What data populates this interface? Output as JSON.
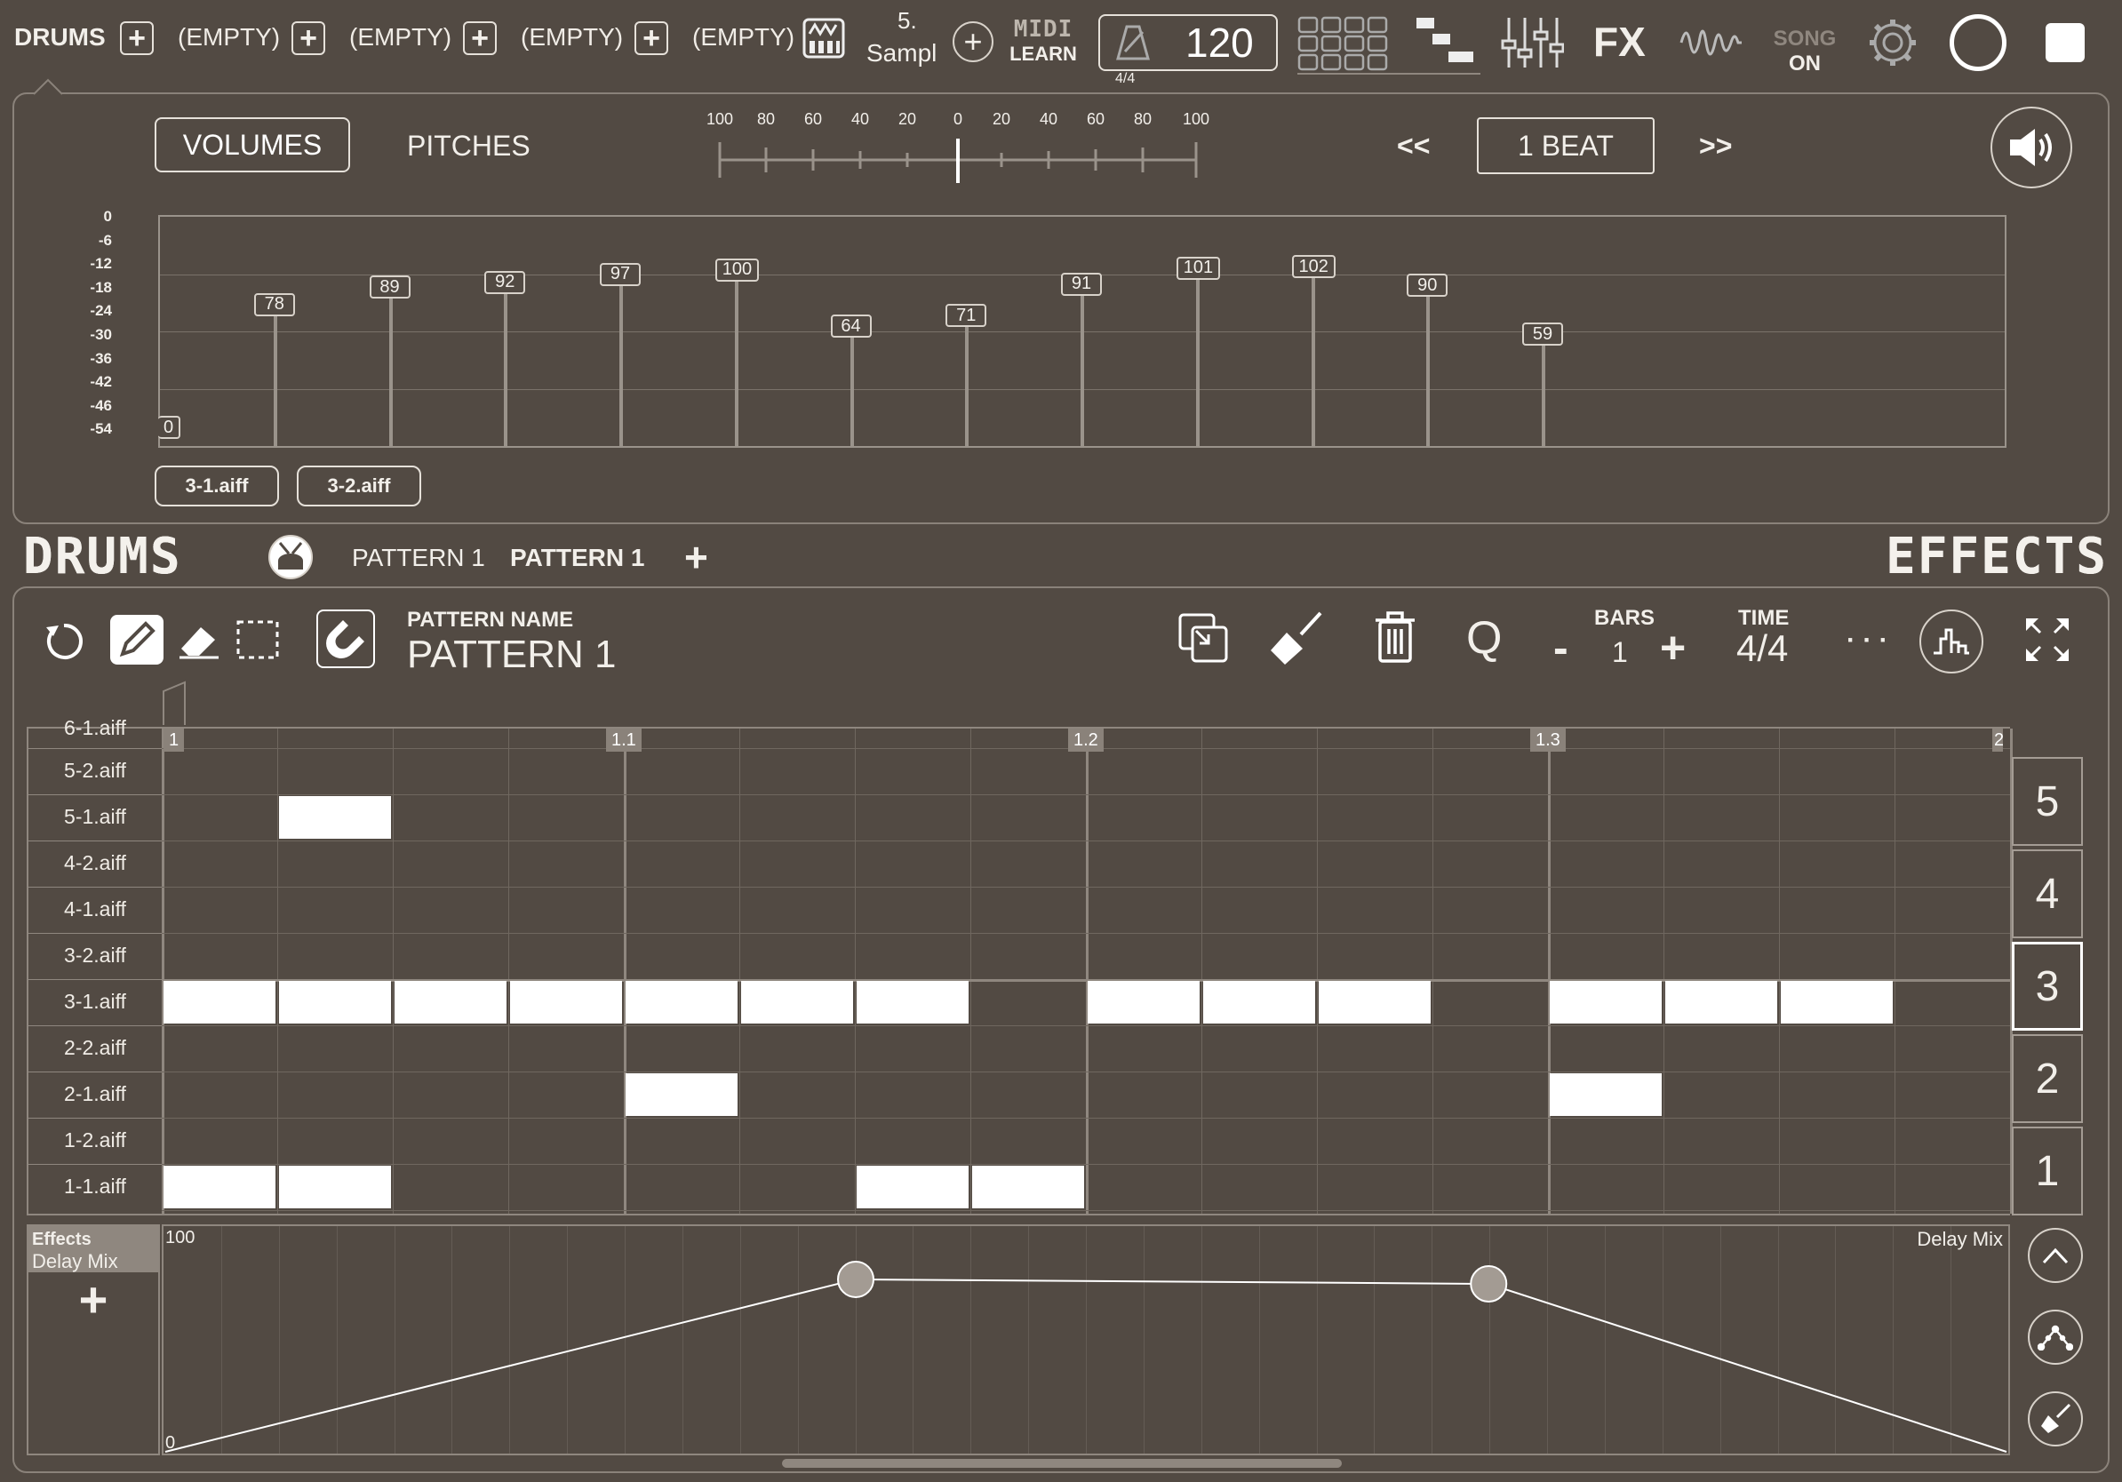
{
  "topbar": {
    "instrument": "DRUMS",
    "slots": [
      "(EMPTY)",
      "(EMPTY)",
      "(EMPTY)",
      "(EMPTY)"
    ],
    "sample_line1": "5.",
    "sample_line2": "Sampl",
    "midi_learn": "LEARN",
    "tempo": "120",
    "time_sig": "4/4",
    "fx": "FX",
    "song_label": "SONG",
    "song_state": "ON"
  },
  "editor": {
    "tabs": [
      "VOLUMES",
      "PITCHES"
    ],
    "active_tab": "VOLUMES",
    "pan_scale": [
      "100",
      "80",
      "60",
      "40",
      "20",
      "0",
      "20",
      "40",
      "60",
      "80",
      "100"
    ],
    "prev": "<<",
    "next": ">>",
    "step": "1 BEAT",
    "db_scale": [
      "0",
      "-6",
      "-12",
      "-18",
      "-24",
      "-30",
      "-36",
      "-42",
      "-46",
      "-54"
    ],
    "velocities": [
      "0",
      "78",
      "89",
      "92",
      "97",
      "100",
      "64",
      "71",
      "91",
      "101",
      "102",
      "90",
      "59"
    ],
    "samples": [
      "3-1.aiff",
      "3-2.aiff"
    ]
  },
  "section": {
    "title": "DRUMS",
    "patterns": [
      "PATTERN 1",
      "PATTERN 1"
    ],
    "add": "+",
    "effects_title": "EFFECTS"
  },
  "toolbar": {
    "pattern_name_label": "PATTERN NAME",
    "pattern_name": "PATTERN 1",
    "quantize": "Q",
    "bars_label": "BARS",
    "bars_value": "1",
    "bars_minus": "-",
    "bars_plus": "+",
    "time_label": "TIME",
    "time_value": "4/4",
    "more": "· · ·"
  },
  "grid": {
    "markers": [
      "1",
      "1.1",
      "1.2",
      "1.3",
      "2"
    ],
    "rows": [
      "6-1.aiff",
      "5-2.aiff",
      "5-1.aiff",
      "4-2.aiff",
      "4-1.aiff",
      "3-2.aiff",
      "3-1.aiff",
      "2-2.aiff",
      "2-1.aiff",
      "1-2.aiff",
      "1-1.aiff"
    ],
    "notes": [
      {
        "row": 2,
        "step": 1
      },
      {
        "row": 6,
        "step": 0
      },
      {
        "row": 6,
        "step": 1
      },
      {
        "row": 6,
        "step": 2
      },
      {
        "row": 6,
        "step": 3
      },
      {
        "row": 6,
        "step": 4
      },
      {
        "row": 6,
        "step": 5
      },
      {
        "row": 6,
        "step": 6
      },
      {
        "row": 6,
        "step": 8
      },
      {
        "row": 6,
        "step": 9
      },
      {
        "row": 6,
        "step": 10
      },
      {
        "row": 6,
        "step": 12
      },
      {
        "row": 6,
        "step": 13
      },
      {
        "row": 6,
        "step": 14
      },
      {
        "row": 8,
        "step": 4
      },
      {
        "row": 8,
        "step": 12
      },
      {
        "row": 10,
        "step": 0
      },
      {
        "row": 10,
        "step": 1
      },
      {
        "row": 10,
        "step": 6
      },
      {
        "row": 10,
        "step": 7
      }
    ],
    "groups": [
      "5",
      "4",
      "3",
      "2",
      "1"
    ],
    "active_group": "3"
  },
  "automation": {
    "heading": "Effects",
    "param": "Delay Mix",
    "add": "+",
    "max": "100",
    "min": "0",
    "label": "Delay Mix",
    "points": [
      [
        0,
        0
      ],
      [
        6,
        77
      ],
      [
        11.5,
        75
      ],
      [
        16,
        0
      ]
    ]
  }
}
